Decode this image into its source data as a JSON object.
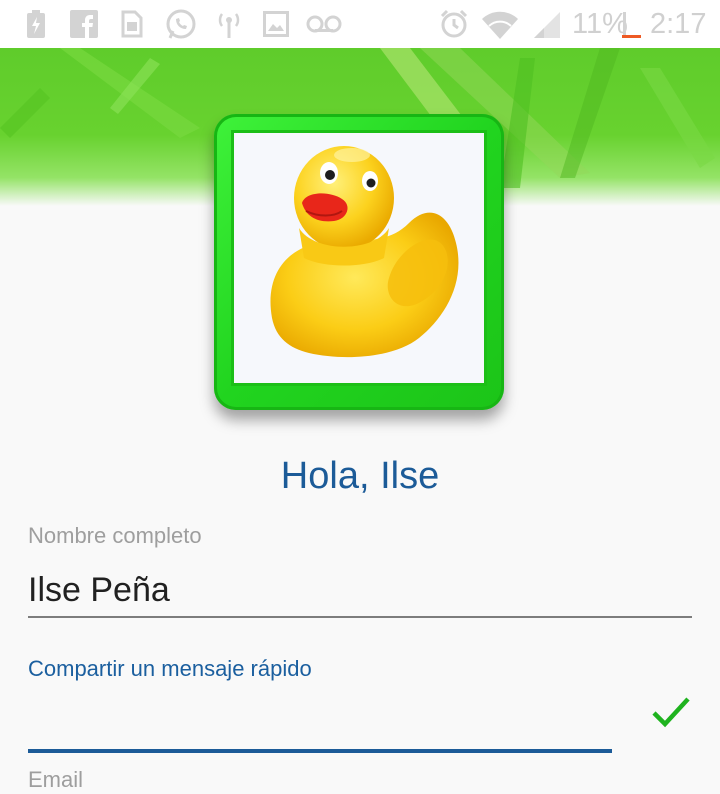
{
  "status_bar": {
    "battery_percent": "11%",
    "time": "2:17",
    "icons": [
      "battery-icon",
      "facebook-icon",
      "sim-icon",
      "whatsapp-icon",
      "antenna-icon",
      "image-icon",
      "voicemail-icon",
      "alarm-icon",
      "wifi-icon",
      "signal-icon",
      "battery-low-icon"
    ]
  },
  "profile": {
    "greeting": "Hola, Ilse",
    "avatar": "rubber-duck-avatar",
    "frame_color": "#24d21f"
  },
  "form": {
    "full_name_label": "Nombre completo",
    "full_name_value": "Ilse Peña",
    "message_label": "Compartir un mensaje rápido",
    "message_value": "",
    "email_label": "Email"
  },
  "colors": {
    "accent_blue": "#1c5b98",
    "check_green": "#1fb31f",
    "banner_green": "#5fcc2b"
  }
}
